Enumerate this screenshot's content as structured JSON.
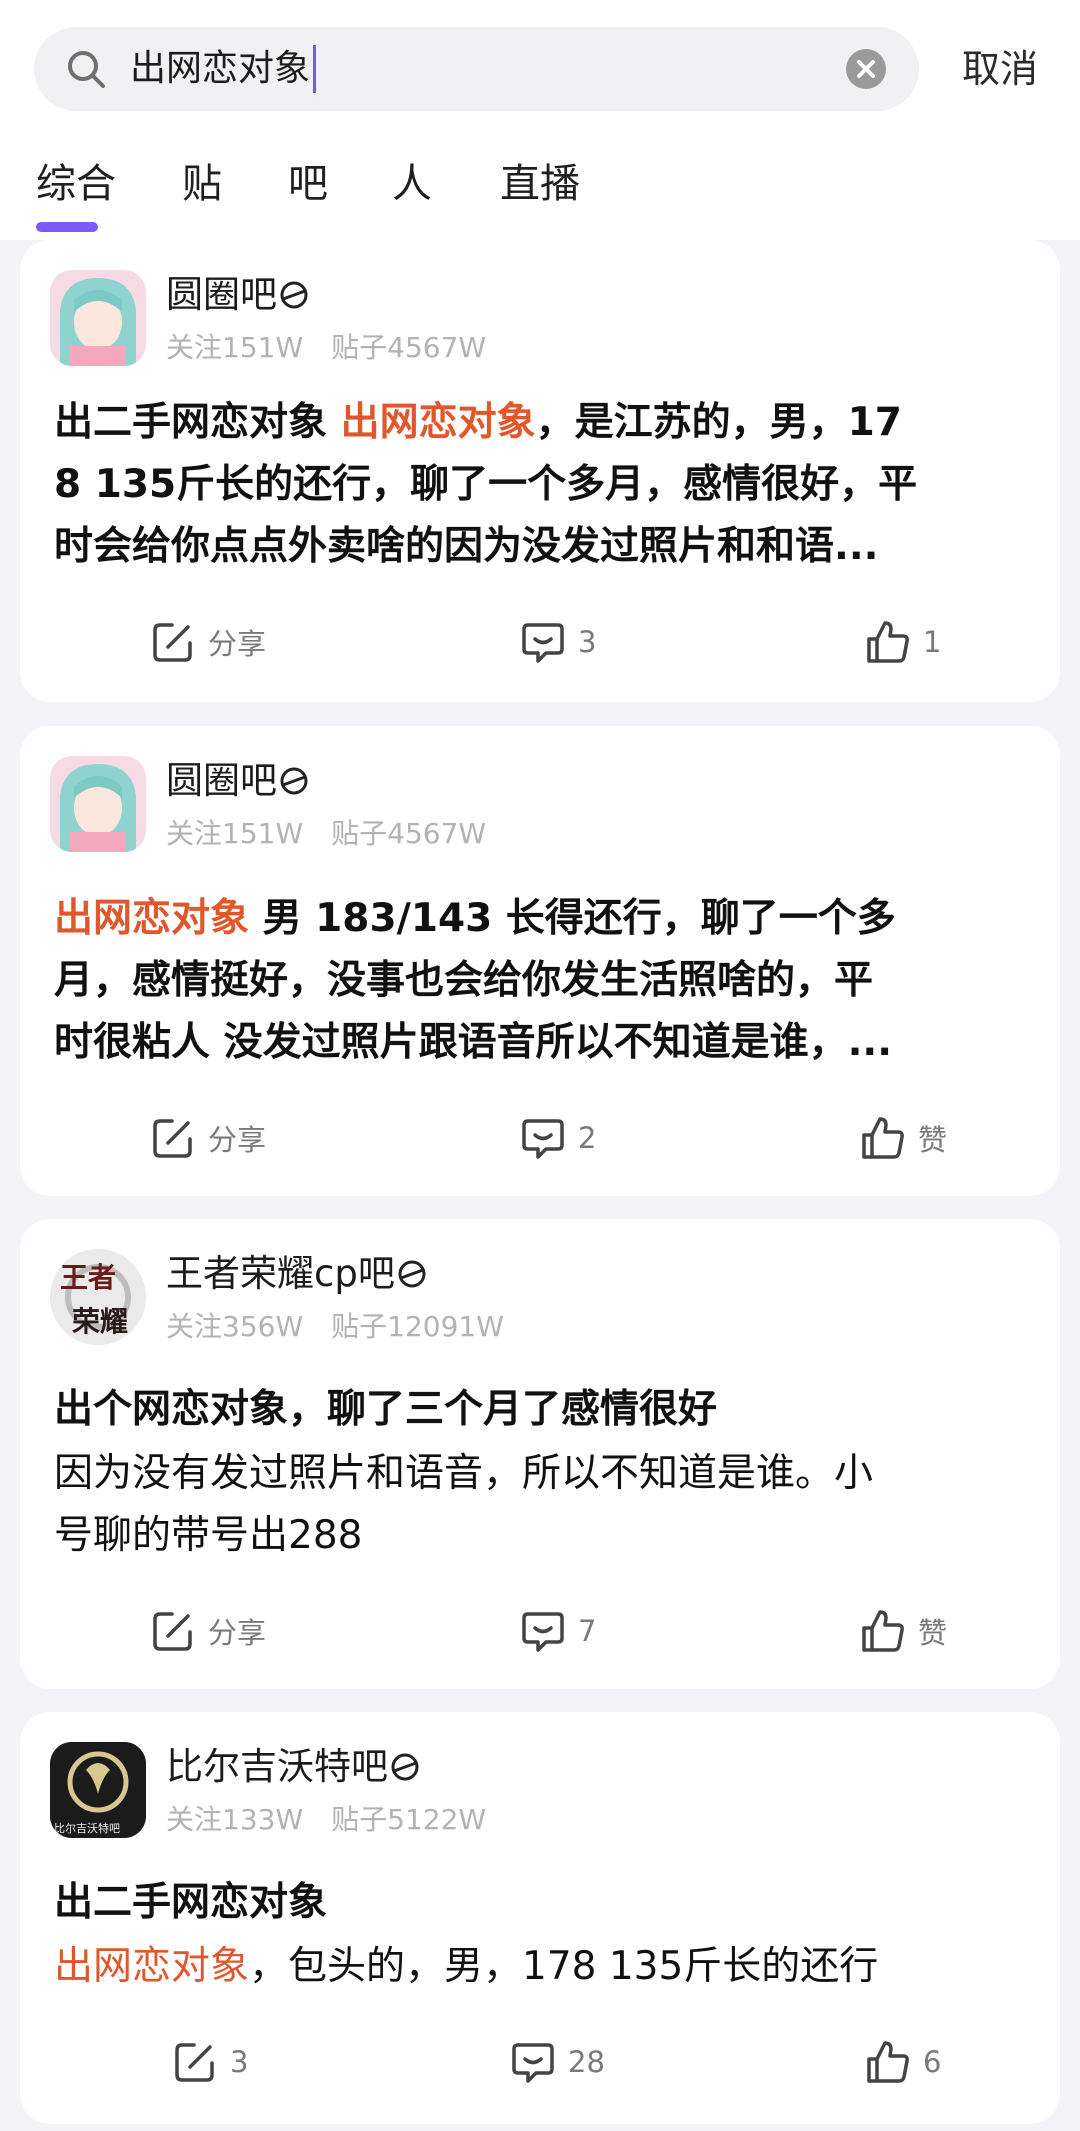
{
  "search": {
    "query": "出网恋对象",
    "cancel_label": "取消"
  },
  "tabs": [
    "综合",
    "贴",
    "吧",
    "人",
    "直播"
  ],
  "posts": [
    {
      "forum": "圆圈吧",
      "followers": "关注151W",
      "posts_count": "贴子4567W",
      "line1_pre": "出二手网恋对象 ",
      "line1_hl": "出网恋对象",
      "line1_post": "，是江苏的，男，17",
      "line2": "8 135斤长的还行，聊了一个多月，感情很好，平",
      "line3": "时会给你点点外卖啥的因为没发过照片和和语...",
      "share_label": "分享",
      "comments": "3",
      "likes": "1"
    },
    {
      "forum": "圆圈吧",
      "followers": "关注151W",
      "posts_count": "贴子4567W",
      "line1_hl": "出网恋对象",
      "line1_post": " 男 183/143 长得还行，聊了一个多",
      "line2": "月，感情挺好，没事也会给你发生活照啥的，平",
      "line3": "时很粘人 没发过照片跟语音所以不知道是谁，...",
      "share_label": "分享",
      "comments": "2",
      "likes": "赞"
    },
    {
      "forum": "王者荣耀cp吧",
      "followers": "关注356W",
      "posts_count": "贴子12091W",
      "title": "出个网恋对象，聊了三个月了感情很好",
      "body1": "因为没有发过照片和语音，所以不知道是谁。小",
      "body2": "号聊的带号出288",
      "avatar_top": "王者",
      "avatar_bottom": "荣耀",
      "share_label": "分享",
      "comments": "7",
      "likes": "赞"
    },
    {
      "forum": "比尔吉沃特吧",
      "followers": "关注133W",
      "posts_count": "贴子5122W",
      "title": "出二手网恋对象",
      "body_hl": "出网恋对象",
      "body_post": "，包头的，男，178 135斤长的还行",
      "avatar_text": "比尔吉沃特吧",
      "shares": "3",
      "comments": "28",
      "likes": "6"
    }
  ],
  "colors": {
    "accent": "#7b5cf6",
    "highlight": "#e0572b",
    "muted": "#b3b3b3"
  }
}
